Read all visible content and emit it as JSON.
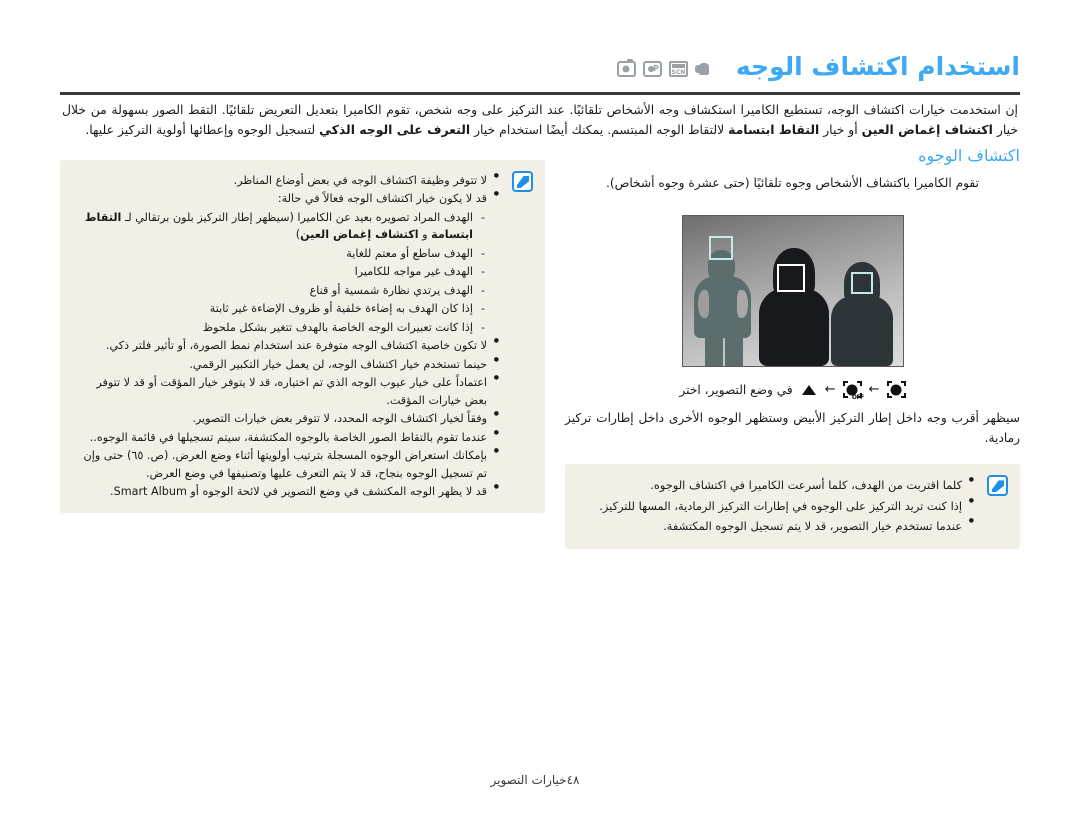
{
  "header": {
    "title": "استخدام اكتشاف الوجه",
    "mode_icons": [
      {
        "name": "hand-dual-is-icon",
        "label": "Dual IS"
      },
      {
        "name": "scene-mode-icon",
        "label": "SCN"
      },
      {
        "name": "program-mode-icon",
        "label": "P"
      },
      {
        "name": "smart-auto-camera-icon",
        "label": "Auto"
      }
    ]
  },
  "intro": {
    "line1": "إن استخدمت خيارات اكتشاف الوجه، تستطيع الكاميرا استكشاف وجه الأشخاص تلقائيًا. عند التركيز على وجه شخص، تقوم الكاميرا بتعديل التعريض تلقائيًا. التقط الصور بسهولة من",
    "line2_a": "خلال خيار ",
    "line2_b1": "اكتشاف إغماض العين",
    "line2_c": " أو خيار ",
    "line2_b2": "التقاط ابتسامة",
    "line2_d": " لالتقاط الوجه المبتسم. يمكنك أيضًا استخدام خيار ",
    "line2_b3": "التعرف على الوجه الذكي",
    "line2_e": " لتسجيل الوجوه وإعطائها أولوية التركيز عليها."
  },
  "left_column": {
    "section_title": "اكتشاف الوجوه",
    "description": "تقوم الكاميرا باكتشاف الأشخاص وجوه تلقائيًا (حتى عشرة وجوه أشخاص).",
    "figure": {
      "name": "face-detection-illustration",
      "alt": "ثلاثة أشخاص مع أطر اكتشاف الوجه"
    },
    "instruction": {
      "text": "في وضع التصوير، اختر",
      "arrow": "←",
      "icon_off_label": "OFF",
      "icon_on_name": "face-detection-on-icon",
      "icon_off_name": "face-detection-off-icon",
      "triangle_name": "mode-triangle-icon"
    },
    "result_text": "سيظهر أقرب وجه داخل إطار التركيز الأبيض وستظهر الوجوه الأخرى داخل إطارات تركيز رمادية.",
    "note": {
      "icon_name": "note-pen-icon",
      "items": [
        "كلما اقتربت من الهدف، كلما أسرعت الكاميرا في اكتشاف الوجوه.",
        "إذا كنت تريد التركيز على الوجوه في إطارات التركيز الرمادية، المسها للتركيز.",
        "عندما تستخدم خيار التصوير، قد لا يتم تسجيل الوجوه المكتشفة."
      ]
    }
  },
  "right_column": {
    "note": {
      "icon_name": "note-pen-icon",
      "items": [
        {
          "type": "bullet",
          "text": "لا تتوفر وظيفة اكتشاف الوجه في بعض أوضاع المناظر."
        },
        {
          "type": "bullet",
          "text": "قد لا يكون خيار اكتشاف الوجه فعالاً في حالة:"
        },
        {
          "type": "sub",
          "text": "الهدف المراد تصويره بعيد عن الكاميرا (سيظهر إطار التركيز بلون برتقالي لـ ",
          "bold1": "التقاط ابتسامة",
          "mid": " و ",
          "bold2": "اكتشاف إغماض العين",
          "tail": ")"
        },
        {
          "type": "sub",
          "text": "الهدف ساطع أو معتم للغاية"
        },
        {
          "type": "sub",
          "text": "الهدف غير مواجه للكاميرا"
        },
        {
          "type": "sub",
          "text": "الهدف يرتدي نظارة شمسية أو قناع"
        },
        {
          "type": "sub",
          "text": "إذا كان الهدف به إضاءة خلفية أو ظروف الإضاءة غير ثابتة"
        },
        {
          "type": "sub",
          "text": "إذا كانت تعبيرات الوجه الخاصة بالهدف تتغير بشكل ملحوظ"
        },
        {
          "type": "bullet",
          "text": "لا تكون خاصية اكتشاف الوجه متوفرة عند استخدام نمط الصورة، أو تأثير فلتر ذكي."
        },
        {
          "type": "bullet",
          "text": "حينما تستخدم خيار اكتشاف الوجه، لن يعمل خيار التكبير الرقمي."
        },
        {
          "type": "bullet",
          "text": "اعتماداً على خيار عيوب الوجه الذي تم اختياره، قد لا يتوفر خيار المؤقت أو قد لا تتوفر بعض خيارات المؤقت."
        },
        {
          "type": "bullet",
          "text": "وفقاً لخيار اكتشاف الوجه المحدد، لا تتوفر بعض خيارات التصوير."
        },
        {
          "type": "bullet",
          "text": "عندما تقوم بالتقاط الصور الخاصة بالوجوه المكتشفة، سيتم تسجيلها في قائمة الوجوه.."
        },
        {
          "type": "bullet",
          "text": "بإمكانك استعراض الوجوه المسجلة بترتيب أولويتها أثناء وضع العرض. (ص. ٦٥) حتى وإن تم تسجيل الوجوه بنجاح، قد لا يتم التعرف عليها وتصنيفها في وضع العرض."
        },
        {
          "type": "bullet",
          "text": "قد لا يظهر الوجه المكتشف في وضع التصوير في لائحة الوجوه أو ",
          "ltr": "Smart Album",
          "tail": "."
        }
      ]
    }
  },
  "footer": {
    "label": "خيارات التصوير",
    "page_number": "٤٨"
  },
  "colors": {
    "title_blue": "#3fa9f5",
    "note_bg": "#f2efe6",
    "note_icon_blue": "#1e90e8",
    "rule_dark": "#3a3a3a"
  }
}
